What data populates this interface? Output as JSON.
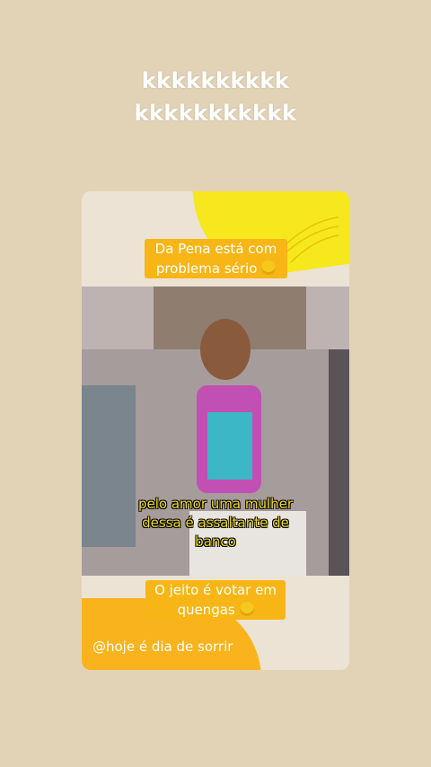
{
  "top_caption": {
    "line1": "kkkkkkkkkk",
    "line2": "kkkkkkkkkkk"
  },
  "card": {
    "header_label": {
      "line1": "Da Pena está com",
      "line2": "problema sério"
    },
    "subtitle": {
      "line1": "pelo amor uma mulher",
      "line2": "dessa é assaltante de",
      "line3": "banco"
    },
    "footer_label": {
      "line1": "O jeito é votar em",
      "line2": "quengas"
    },
    "handle": "@hoje é dia de sorrir"
  },
  "icons": {
    "laugh": "rolling-laughing-emoji-icon"
  },
  "colors": {
    "background": "#e2d3b7",
    "label_bg": "#f7b616",
    "subtitle_text": "#f1dc1b",
    "accent_yellow": "#f6e81c",
    "accent_orange": "#f9b31c"
  }
}
